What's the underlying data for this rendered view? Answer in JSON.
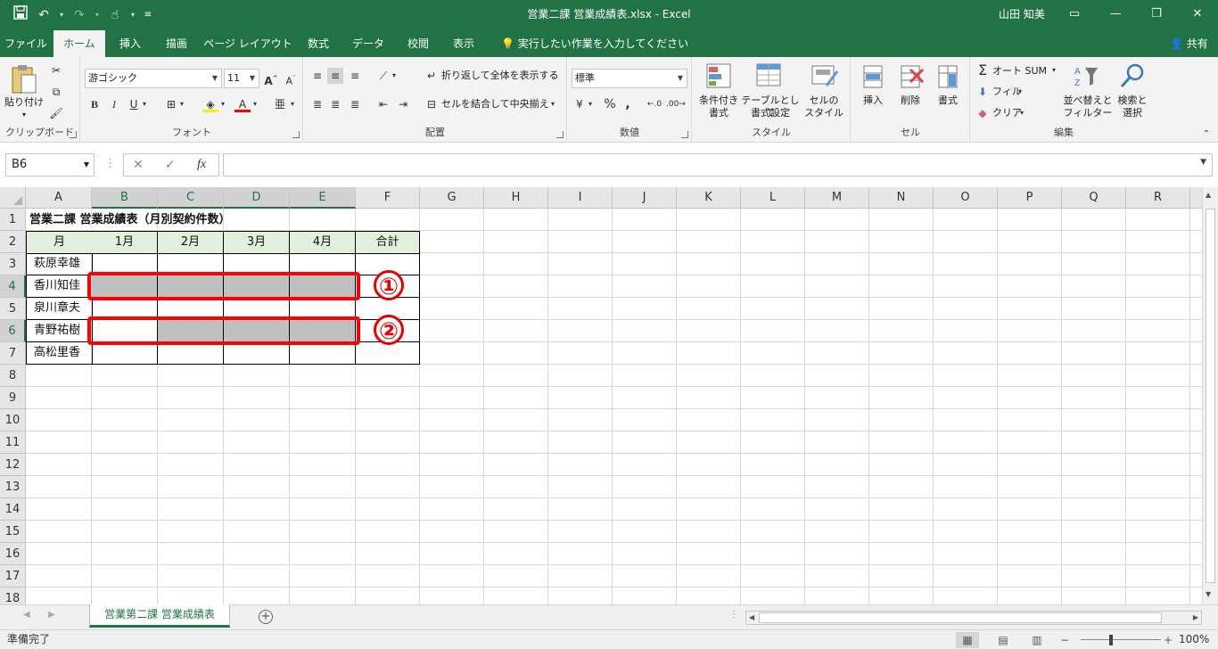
{
  "window": {
    "title": "営業二課 営業成績表.xlsx  -  Excel",
    "user": "山田 知美"
  },
  "tabs": [
    "ファイル",
    "ホーム",
    "挿入",
    "描画",
    "ページ レイアウト",
    "数式",
    "データ",
    "校閲",
    "表示"
  ],
  "tell_me": "実行したい作業を入力してください",
  "share": "共有",
  "ribbon": {
    "clipboard": {
      "paste": "貼り付け",
      "label": "クリップボード"
    },
    "font": {
      "name": "游ゴシック",
      "size": "11",
      "label": "フォント",
      "bold": "B",
      "italic": "I",
      "underline": "U"
    },
    "alignment": {
      "wrap": "折り返して全体を表示する",
      "merge": "セルを結合して中央揃え",
      "label": "配置"
    },
    "number": {
      "format": "標準",
      "label": "数値",
      "percent": "%",
      "comma": ","
    },
    "styles": {
      "conditional_1": "条件付き",
      "conditional_2": "書式",
      "table_1": "テーブルとして",
      "table_2": "書式設定",
      "cell_1": "セルの",
      "cell_2": "スタイル",
      "label": "スタイル"
    },
    "cells": {
      "insert": "挿入",
      "delete": "削除",
      "format": "書式",
      "label": "セル"
    },
    "editing": {
      "autosum": "オート SUM",
      "fill": "フィル",
      "clear": "クリア",
      "sort_1": "並べ替えと",
      "sort_2": "フィルター",
      "find_1": "検索と",
      "find_2": "選択",
      "label": "編集"
    }
  },
  "formula_bar": {
    "name_box": "B6",
    "cancel": "✕",
    "enter": "✓",
    "fx": "fx",
    "value": ""
  },
  "columns": [
    "A",
    "B",
    "C",
    "D",
    "E",
    "F",
    "G",
    "H",
    "I",
    "J",
    "K",
    "L",
    "M",
    "N",
    "O",
    "P",
    "Q",
    "R"
  ],
  "rows": [
    "1",
    "2",
    "3",
    "4",
    "5",
    "6",
    "7",
    "8",
    "9",
    "10",
    "11",
    "12",
    "13",
    "14",
    "15",
    "16",
    "17",
    "18"
  ],
  "sheet": {
    "title": "営業二課 営業成績表（月別契約件数）",
    "headers": [
      "月",
      "1月",
      "2月",
      "3月",
      "4月",
      "合計"
    ],
    "names": [
      "萩原幸雄",
      "香川知佳",
      "泉川章夫",
      "青野祐樹",
      "高松里香"
    ]
  },
  "annotations": [
    "①",
    "②"
  ],
  "sheet_tab": "営業第二課 営業成績表",
  "status": {
    "ready": "準備完了",
    "zoom": "100%"
  }
}
